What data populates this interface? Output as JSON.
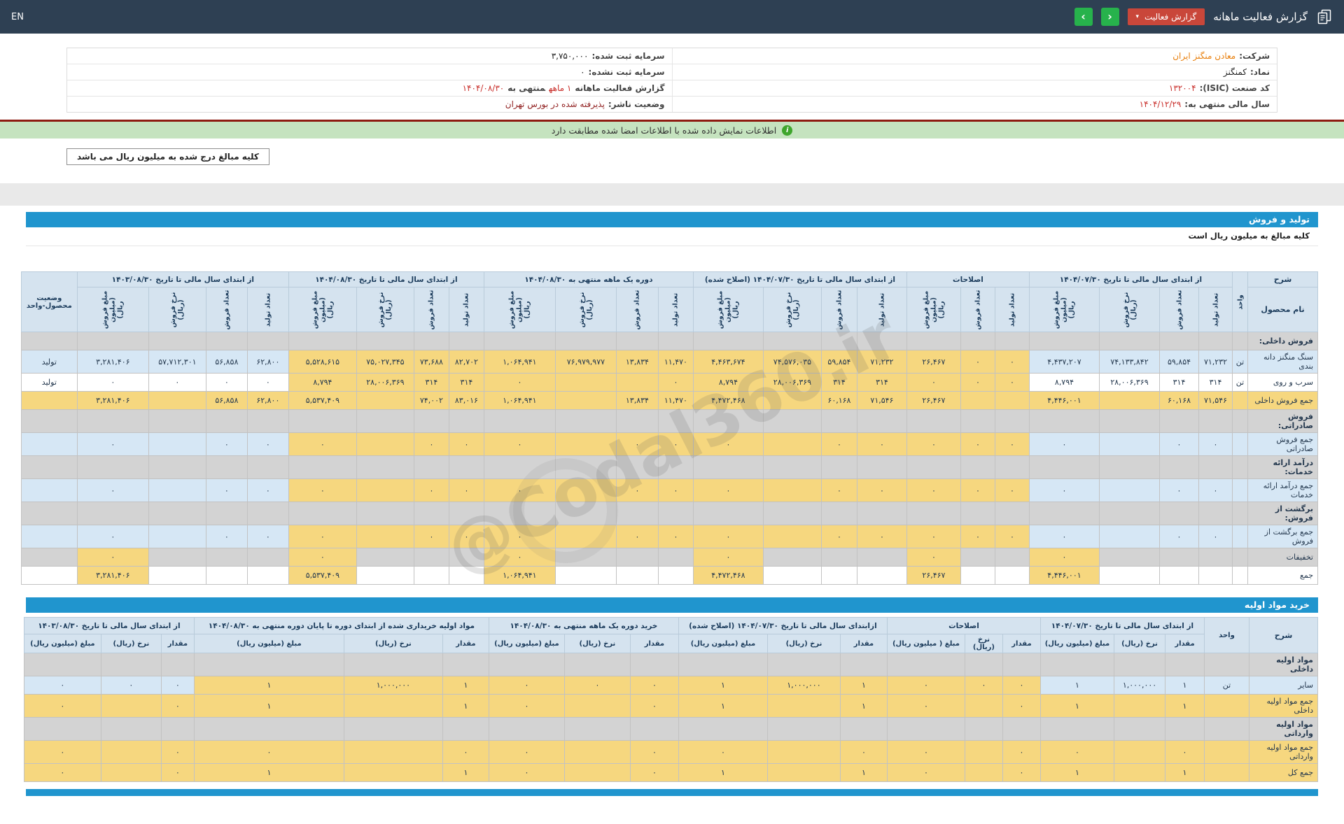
{
  "topbar": {
    "title": "گزارش فعالیت ماهانه",
    "report_button": "گزارش فعالیت",
    "lang": "EN",
    "icons": {
      "caret": "▾",
      "next": "›",
      "prev": "‹",
      "info": "i"
    }
  },
  "info": {
    "right": [
      {
        "link": true,
        "parts": [
          {
            "t": "شرکت:",
            "c": "lbl"
          },
          {
            "t": "معادن منگنز ایران",
            "c": "org"
          }
        ]
      },
      {
        "parts": [
          {
            "t": "نماد:",
            "c": "lbl"
          },
          {
            "t": "کمنگنز",
            "c": "val"
          }
        ]
      },
      {
        "parts": [
          {
            "t": "کد صنعت (ISIC):",
            "c": "lbl"
          },
          {
            "t": "۱۳۲۰۰۴",
            "c": "red"
          }
        ]
      },
      {
        "parts": [
          {
            "t": "سال مالی منتهی به:",
            "c": "lbl"
          },
          {
            "t": "۱۴۰۴/۱۲/۲۹",
            "c": "red"
          }
        ]
      }
    ],
    "left": [
      {
        "parts": [
          {
            "t": "سرمایه ثبت شده:",
            "c": "lbl"
          },
          {
            "t": "۳,۷۵۰,۰۰۰",
            "c": "val"
          }
        ]
      },
      {
        "parts": [
          {
            "t": "سرمایه ثبت نشده:",
            "c": "lbl"
          },
          {
            "t": "۰",
            "c": "val"
          }
        ]
      },
      {
        "parts": [
          {
            "t": "گزارش فعالیت ماهانه",
            "c": "lbl"
          },
          {
            "t": "۱ ماهه",
            "c": "red"
          },
          {
            "t": "منتهی به",
            "c": "lbl"
          },
          {
            "t": "۱۴۰۴/۰۸/۳۰",
            "c": "red"
          }
        ]
      },
      {
        "parts": [
          {
            "t": "وضعیت ناشر:",
            "c": "lbl"
          },
          {
            "t": "پذیرفته شده در بورس تهران",
            "c": "drk"
          }
        ]
      }
    ]
  },
  "notice": {
    "text": "اطلاعات نمایش داده شده با اطلاعات امضا شده مطابقت دارد"
  },
  "amount_note": "کلیه مبالغ درج شده به میلیون ریال می باشد",
  "watermark": "@Codal360.ir",
  "sections": {
    "production": {
      "title": "تولید و فروش",
      "unit_note": "کلیه مبالغ به میلیون ریال است"
    },
    "materials": {
      "title": "خرید مواد اولیه"
    }
  },
  "tables": [
    {
      "id": "table1",
      "sharh": "شرح",
      "product_label": "نام محصول",
      "unit_label": "واحد",
      "status_label": "وضعیت محصول-واحد",
      "vertical": true,
      "tan_from": 4,
      "tan_to": 18,
      "money": [
        3,
        6,
        10,
        14,
        18,
        22
      ],
      "widths": [
        100,
        22,
        48,
        56,
        86,
        100,
        49,
        49,
        77,
        71,
        51,
        83,
        100,
        50,
        60,
        87,
        102,
        50,
        50,
        82,
        97,
        59,
        59,
        82,
        102,
        80
      ],
      "groups": [
        {
          "title": "از ابتدای سال مالی تا تاریخ ۱۴۰۴/۰۷/۳۰",
          "cols": [
            "تعداد تولید",
            "تعداد فروش",
            "نرخ فروش (ریال)",
            "مبلغ فروش (میلیون ریال)"
          ]
        },
        {
          "title": "اصلاحات",
          "cols": [
            "تعداد تولید",
            "تعداد فروش",
            "مبلغ فروش (میلیون ریال)"
          ]
        },
        {
          "title": "از ابتدای سال مالی تا تاریخ ۱۴۰۴/۰۷/۳۰ (اصلاح شده)",
          "cols": [
            "تعداد تولید",
            "تعداد فروش",
            "نرخ فروش (ریال)",
            "مبلغ فروش (میلیون ریال)"
          ]
        },
        {
          "title": "دوره یک ماهه منتهی به ۱۴۰۴/۰۸/۳۰",
          "cols": [
            "تعداد تولید",
            "تعداد فروش",
            "نرخ فروش (ریال)",
            "مبلغ فروش (میلیون ریال)"
          ]
        },
        {
          "title": "از ابتدای سال مالی تا تاریخ ۱۴۰۴/۰۸/۳۰",
          "cols": [
            "تعداد تولید",
            "تعداد فروش",
            "نرخ فروش (ریال)",
            "مبلغ فروش (میلیون ریال)"
          ]
        },
        {
          "title": "از ابتدای سال مالی تا تاریخ ۱۴۰۳/۰۸/۳۰",
          "cols": [
            "تعداد تولید",
            "تعداد فروش",
            "نرخ فروش (ریال)",
            "مبلغ فروش (میلیون ریال)"
          ]
        }
      ],
      "rows": [
        {
          "name": "فروش داخلی:",
          "variant": "section",
          "unit": "",
          "status": "",
          "cells": [
            "",
            "",
            "",
            "",
            "",
            "",
            "",
            "",
            "",
            "",
            "",
            "",
            "",
            "",
            "",
            "",
            "",
            "",
            "",
            "",
            "",
            "",
            ""
          ]
        },
        {
          "name": "سنگ منگنز دانه بندی",
          "variant": "blue",
          "unit": "تن",
          "status": "تولید",
          "cells": [
            "۷۱,۲۳۲",
            "۵۹,۸۵۴",
            "۷۴,۱۳۳,۸۴۲",
            "۴,۴۳۷,۲۰۷",
            "۰",
            "۰",
            "۲۶,۴۶۷",
            "۷۱,۲۳۲",
            "۵۹,۸۵۴",
            "۷۴,۵۷۶,۰۳۵",
            "۴,۴۶۳,۶۷۴",
            "۱۱,۴۷۰",
            "۱۳,۸۳۴",
            "۷۶,۹۷۹,۹۷۷",
            "۱,۰۶۴,۹۴۱",
            "۸۲,۷۰۲",
            "۷۳,۶۸۸",
            "۷۵,۰۲۷,۳۴۵",
            "۵,۵۲۸,۶۱۵",
            "۶۲,۸۰۰",
            "۵۶,۸۵۸",
            "۵۷,۷۱۲,۳۰۱",
            "۳,۲۸۱,۴۰۶"
          ]
        },
        {
          "name": "سرب و روی",
          "variant": "white",
          "unit": "تن",
          "status": "تولید",
          "cells": [
            "۳۱۴",
            "۳۱۴",
            "۲۸,۰۰۶,۳۶۹",
            "۸,۷۹۴",
            "۰",
            "۰",
            "۰",
            "۳۱۴",
            "۳۱۴",
            "۲۸,۰۰۶,۳۶۹",
            "۸,۷۹۴",
            "۰",
            "",
            "",
            "۰",
            "۳۱۴",
            "۳۱۴",
            "۲۸,۰۰۶,۳۶۹",
            "۸,۷۹۴",
            "۰",
            "۰",
            "۰",
            "۰"
          ]
        },
        {
          "name": "جمع فروش داخلی",
          "variant": "tan",
          "unit": "",
          "status": "",
          "cells": [
            "۷۱,۵۴۶",
            "۶۰,۱۶۸",
            "",
            "۴,۴۴۶,۰۰۱",
            "",
            "",
            "۲۶,۴۶۷",
            "۷۱,۵۴۶",
            "۶۰,۱۶۸",
            "",
            "۴,۴۷۲,۴۶۸",
            "۱۱,۴۷۰",
            "۱۳,۸۳۴",
            "",
            "۱,۰۶۴,۹۴۱",
            "۸۳,۰۱۶",
            "۷۴,۰۰۲",
            "",
            "۵,۵۳۷,۴۰۹",
            "۶۲,۸۰۰",
            "۵۶,۸۵۸",
            "",
            "۳,۲۸۱,۴۰۶"
          ]
        },
        {
          "name": "فروش صادراتی:",
          "variant": "section",
          "unit": "",
          "status": "",
          "cells": [
            "",
            "",
            "",
            "",
            "",
            "",
            "",
            "",
            "",
            "",
            "",
            "",
            "",
            "",
            "",
            "",
            "",
            "",
            "",
            "",
            "",
            "",
            ""
          ]
        },
        {
          "name": "جمع فروش صادراتی",
          "variant": "blue",
          "unit": "",
          "status": "",
          "cells": [
            "۰",
            "۰",
            "",
            "۰",
            "۰",
            "۰",
            "۰",
            "۰",
            "۰",
            "",
            "۰",
            "۰",
            "۰",
            "",
            "۰",
            "۰",
            "۰",
            "",
            "۰",
            "۰",
            "۰",
            "",
            "۰"
          ]
        },
        {
          "name": "درآمد ارائه خدمات:",
          "variant": "section",
          "unit": "",
          "status": "",
          "cells": [
            "",
            "",
            "",
            "",
            "",
            "",
            "",
            "",
            "",
            "",
            "",
            "",
            "",
            "",
            "",
            "",
            "",
            "",
            "",
            "",
            "",
            "",
            ""
          ]
        },
        {
          "name": "جمع درآمد ارائه خدمات",
          "variant": "blue",
          "unit": "",
          "status": "",
          "cells": [
            "۰",
            "۰",
            "",
            "۰",
            "۰",
            "۰",
            "۰",
            "۰",
            "۰",
            "",
            "۰",
            "۰",
            "۰",
            "",
            "۰",
            "۰",
            "۰",
            "",
            "۰",
            "۰",
            "۰",
            "",
            "۰"
          ]
        },
        {
          "name": "برگشت از فروش:",
          "variant": "section",
          "unit": "",
          "status": "",
          "cells": [
            "",
            "",
            "",
            "",
            "",
            "",
            "",
            "",
            "",
            "",
            "",
            "",
            "",
            "",
            "",
            "",
            "",
            "",
            "",
            "",
            "",
            "",
            ""
          ]
        },
        {
          "name": "جمع برگشت از فروش",
          "variant": "blue",
          "unit": "",
          "status": "",
          "cells": [
            "۰",
            "۰",
            "",
            "۰",
            "۰",
            "۰",
            "۰",
            "۰",
            "۰",
            "",
            "۰",
            "۰",
            "۰",
            "",
            "۰",
            "۰",
            "۰",
            "",
            "۰",
            "۰",
            "۰",
            "",
            "۰"
          ]
        },
        {
          "name": "تخفیفات",
          "variant": "graytan",
          "unit": "",
          "status": "",
          "cells": [
            "",
            "",
            "",
            "۰",
            "",
            "",
            "۰",
            "",
            "",
            "",
            "۰",
            "",
            "",
            "",
            "۰",
            "",
            "",
            "",
            "۰",
            "",
            "",
            "",
            "۰"
          ]
        },
        {
          "name": "جمع",
          "variant": "whitetan",
          "unit": "",
          "status": "",
          "cells": [
            "",
            "",
            "",
            "۴,۴۴۶,۰۰۱",
            "",
            "",
            "۲۶,۴۶۷",
            "",
            "",
            "",
            "۴,۴۷۲,۴۶۸",
            "",
            "",
            "",
            "۱,۰۶۴,۹۴۱",
            "",
            "",
            "",
            "۵,۵۳۷,۴۰۹",
            "",
            "",
            "",
            "۳,۲۸۱,۴۰۶"
          ]
        }
      ]
    },
    {
      "id": "table2",
      "sharh": "شرح",
      "unit_label": "واحد",
      "vertical": false,
      "tan_from": 3,
      "tan_to": 14,
      "money": [
        2,
        5,
        8,
        11,
        14,
        17
      ],
      "widths": [
        98,
        64,
        56,
        73,
        105,
        54,
        54,
        111,
        67,
        104,
        127,
        69,
        94,
        108,
        66,
        141,
        214,
        47,
        86,
        110
      ],
      "groups": [
        {
          "title": "از ابتدای سال مالی تا تاریخ ۱۴۰۴/۰۷/۳۰",
          "cols": [
            "مقدار",
            "نرخ (ریال)",
            "مبلغ (میلیون ریال)"
          ]
        },
        {
          "title": "اصلاحات",
          "cols": [
            "مقدار",
            "نرخ (ریال)",
            "مبلغ ( میلیون ریال)"
          ]
        },
        {
          "title": "ازابتدای سال مالی تا تاریخ ۱۴۰۴/۰۷/۳۰ (اصلاح شده)",
          "cols": [
            "مقدار",
            "نرخ (ریال)",
            "مبلغ (میلیون ریال)"
          ]
        },
        {
          "title": "خرید دوره یک ماهه منتهی به ۱۴۰۴/۰۸/۳۰",
          "cols": [
            "مقدار",
            "نرخ (ریال)",
            "مبلغ (میلیون ریال)"
          ]
        },
        {
          "title": "مواد اولیه خریداری شده از ابتدای دوره تا پایان دوره منتهی به ۱۴۰۴/۰۸/۳۰",
          "cols": [
            "مقدار",
            "نرخ (ریال)",
            "مبلغ (میلیون ریال)"
          ]
        },
        {
          "title": "از ابتدای سال مالی تا تاریخ ۱۴۰۳/۰۸/۳۰",
          "cols": [
            "مقدار",
            "نرخ (ریال)",
            "مبلغ (میلیون ریال)"
          ]
        }
      ],
      "rows": [
        {
          "name": "مواد اولیه داخلی",
          "variant": "section",
          "unit": "",
          "cells": [
            "",
            "",
            "",
            "",
            "",
            "",
            "",
            "",
            "",
            "",
            "",
            "",
            "",
            "",
            "",
            "",
            "",
            ""
          ]
        },
        {
          "name": "سایر",
          "variant": "blue",
          "unit": "تن",
          "cells": [
            "۱",
            "۱,۰۰۰,۰۰۰",
            "۱",
            "۰",
            "۰",
            "۰",
            "۱",
            "۱,۰۰۰,۰۰۰",
            "۱",
            "۰",
            "۰",
            "۰",
            "۱",
            "۱,۰۰۰,۰۰۰",
            "۱",
            "۰",
            "۰",
            "۰"
          ]
        },
        {
          "name": "جمع مواد اولیه داخلی",
          "variant": "tan",
          "unit": "",
          "cells": [
            "۱",
            "",
            "۱",
            "۰",
            "",
            "۰",
            "۱",
            "",
            "۱",
            "۰",
            "",
            "۰",
            "۱",
            "",
            "۱",
            "۰",
            "",
            "۰"
          ]
        },
        {
          "name": "مواد اولیه وارداتی",
          "variant": "section",
          "unit": "",
          "cells": [
            "",
            "",
            "",
            "",
            "",
            "",
            "",
            "",
            "",
            "",
            "",
            "",
            "",
            "",
            "",
            "",
            "",
            ""
          ]
        },
        {
          "name": "جمع مواد اولیه وارداتی",
          "variant": "tan",
          "unit": "",
          "cells": [
            "۰",
            "",
            "۰",
            "۰",
            "",
            "۰",
            "۰",
            "",
            "۰",
            "۰",
            "",
            "۰",
            "۰",
            "",
            "۰",
            "۰",
            "",
            "۰"
          ]
        },
        {
          "name": "جمع کل",
          "variant": "tan",
          "unit": "",
          "cells": [
            "۱",
            "",
            "۱",
            "۰",
            "",
            "۰",
            "۱",
            "",
            "۱",
            "۰",
            "",
            "۰",
            "۱",
            "",
            "۱",
            "۰",
            "",
            "۰"
          ]
        }
      ]
    }
  ]
}
